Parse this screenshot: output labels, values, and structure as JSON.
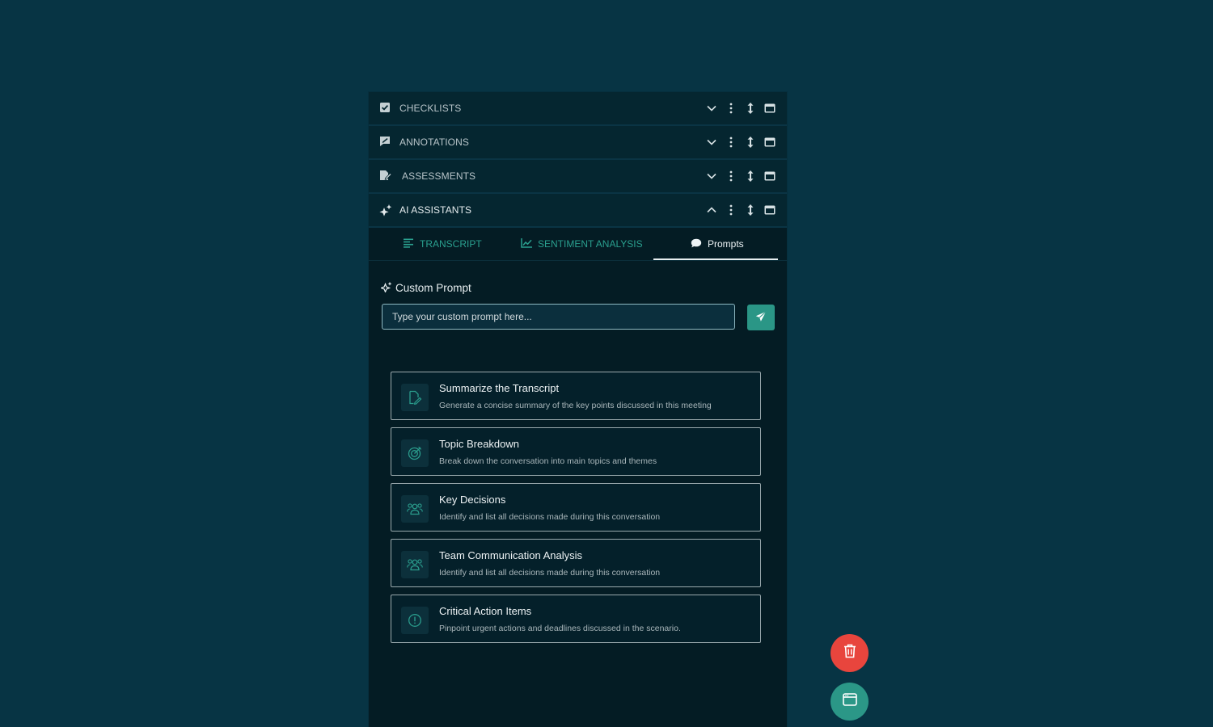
{
  "colors": {
    "page_bg": "#073444",
    "panel_bg": "#041c24",
    "accent": "#2a9686",
    "danger": "#e8453d"
  },
  "sections": [
    {
      "label": "CHECKLISTS",
      "icon": "checkbox-icon",
      "expanded": false
    },
    {
      "label": "ANNOTATIONS",
      "icon": "annotation-icon",
      "expanded": false
    },
    {
      "label": "ASSESSMENTS",
      "icon": "assessment-icon",
      "expanded": false
    },
    {
      "label": "AI ASSISTANTS",
      "icon": "sparkle-icon",
      "expanded": true
    }
  ],
  "tabs": [
    {
      "label": "TRANSCRIPT",
      "icon": "transcript-icon"
    },
    {
      "label": "SENTIMENT ANALYSIS",
      "icon": "chart-line-icon"
    },
    {
      "label": "Prompts",
      "icon": "chat-bubble-icon",
      "active": true
    }
  ],
  "custom_prompt": {
    "title": "Custom Prompt",
    "placeholder": "Type your custom prompt here..."
  },
  "prompt_cards": [
    {
      "title": "Summarize the Transcript",
      "description": "Generate a concise summary of the key points discussed in this meeting",
      "icon": "document-edit-icon"
    },
    {
      "title": "Topic Breakdown",
      "description": "Break down the conversation into main topics and themes",
      "icon": "target-icon"
    },
    {
      "title": "Key Decisions",
      "description": "Identify and list all decisions made during this conversation",
      "icon": "group-icon"
    },
    {
      "title": "Team Communication Analysis",
      "description": "Identify and list all decisions made during this conversation",
      "icon": "group-icon"
    },
    {
      "title": "Critical Action Items",
      "description": "Pinpoint urgent actions and deadlines discussed in the scenario.",
      "icon": "alert-circle-icon"
    }
  ]
}
